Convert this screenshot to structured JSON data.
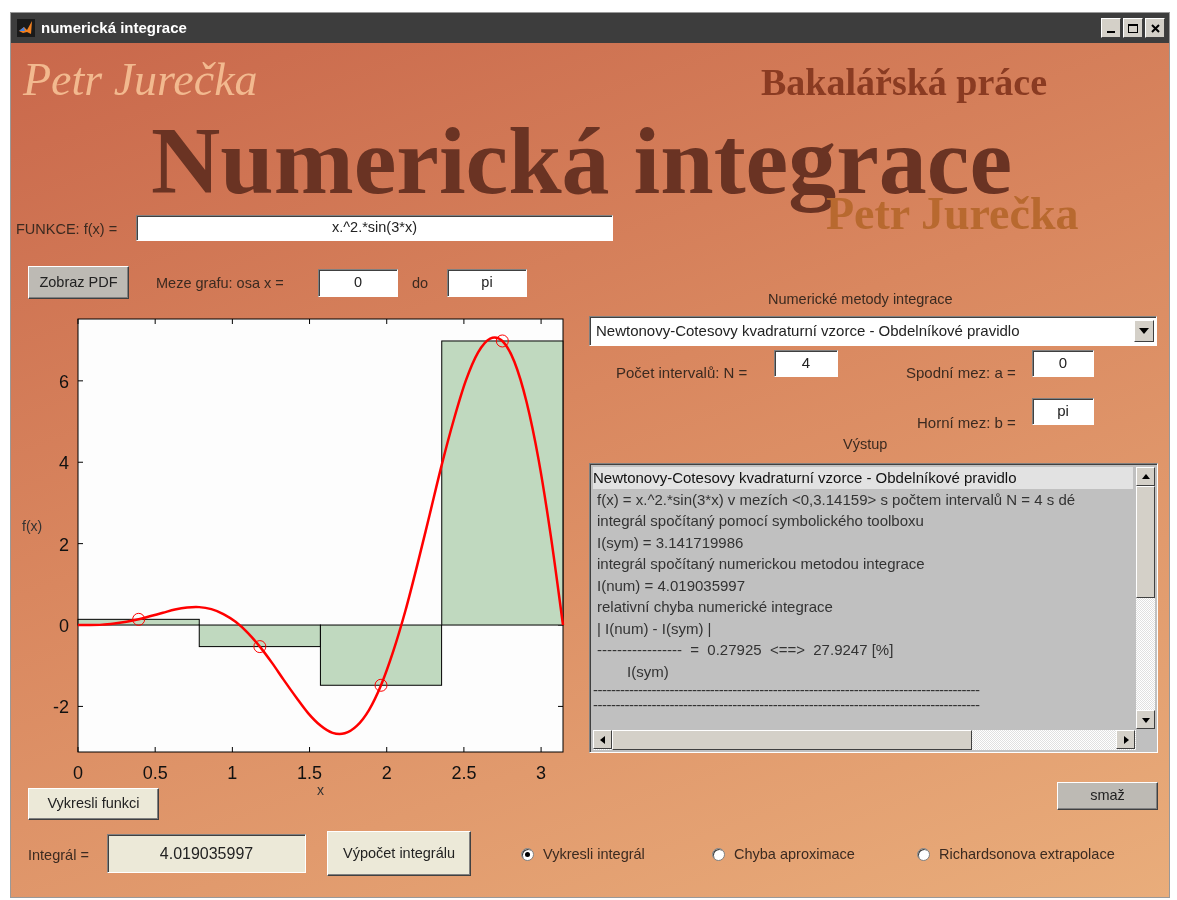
{
  "window": {
    "title": "numerická integrace"
  },
  "background_texts": [
    {
      "text": "Petr Jurečka",
      "kind": "signature"
    },
    {
      "text": "Bakalářská práce",
      "kind": "subtitle"
    },
    {
      "text": "Numerická integrace",
      "kind": "headline"
    },
    {
      "text": "Petr Jurečka",
      "kind": "emblem"
    }
  ],
  "function": {
    "label": "FUNKCE: f(x) =",
    "value": "x.^2.*sin(3*x)"
  },
  "pdf_button": "Zobraz PDF",
  "graph_limits": {
    "label": "Meze grafu: osa x =",
    "from": "0",
    "to_label": "do",
    "to": "pi"
  },
  "methods": {
    "label": "Numerické metody integrace",
    "selected": "Newtonovy-Cotesovy kvadraturní vzorce - Obdelníkové pravidlo"
  },
  "parameters": [
    {
      "label": "Počet intervalů: N =",
      "value": "4"
    },
    {
      "label": "Spodní mez: a =",
      "value": "0"
    },
    {
      "label": "Horní mez: b =",
      "value": "pi"
    }
  ],
  "output": {
    "label": "Výstup",
    "lines": [
      {
        "text": "Newtonovy-Cotesovy kvadraturní vzorce - Obdelníkové pravidlo",
        "kind": "heading",
        "selected": true
      },
      {
        "text": "f(x) = x.^2.*sin(3*x) v mezích <0,3.14159> s počtem intervalů N = 4 s dé",
        "kind": "text",
        "selected": false
      },
      {
        "text": "integrál spočítaný pomocí symbolického toolboxu",
        "kind": "text",
        "selected": false
      },
      {
        "text": "I(sym) = 3.141719986",
        "kind": "text",
        "selected": false
      },
      {
        "text": "integrál spočítaný numerickou metodou integrace",
        "kind": "text",
        "selected": false
      },
      {
        "text": "I(num) = 4.019035997",
        "kind": "text",
        "selected": false
      },
      {
        "text": "relativní chyba numerické integrace",
        "kind": "text",
        "selected": false
      },
      {
        "text": "| I(num) - I(sym) |",
        "kind": "text",
        "selected": false
      },
      {
        "text": "-----------------  =  0.27925  <==>  27.9247 [%]",
        "kind": "text",
        "selected": false
      },
      {
        "text": "I(sym)",
        "kind": "denominator",
        "selected": false
      },
      {
        "text": "--------------------------------------------------------------------------------------",
        "kind": "rule",
        "selected": false
      },
      {
        "text": "--------------------------------------------------------------------------------------",
        "kind": "rule",
        "selected": false
      }
    ]
  },
  "plot": {
    "chart_data": {
      "type": "line",
      "xlabel": "x",
      "ylabel": "f(x)",
      "xlim": [
        0,
        3.142
      ],
      "ylim": [
        -3.12,
        7.52
      ],
      "xticks": [
        0,
        0.5,
        1,
        1.5,
        2,
        2.5,
        3
      ],
      "yticks": [
        -2,
        0,
        2,
        4,
        6
      ],
      "x": [
        0,
        0.079,
        0.157,
        0.236,
        0.314,
        0.393,
        0.471,
        0.55,
        0.628,
        0.707,
        0.785,
        0.864,
        0.942,
        1.021,
        1.1,
        1.178,
        1.257,
        1.335,
        1.414,
        1.492,
        1.571,
        1.649,
        1.728,
        1.806,
        1.885,
        1.963,
        2.042,
        2.121,
        2.199,
        2.278,
        2.356,
        2.435,
        2.513,
        2.592,
        2.67,
        2.749,
        2.827,
        2.906,
        2.985,
        3.063,
        3.142
      ],
      "series": [
        {
          "type": "bar",
          "color": "#c0d9bf",
          "values": [
            null,
            null,
            null,
            null,
            null,
            0.14,
            null,
            null,
            null,
            null,
            null,
            null,
            null,
            null,
            null,
            -0.53,
            null,
            null,
            null,
            null,
            null,
            null,
            null,
            null,
            null,
            -1.48,
            null,
            null,
            null,
            null,
            null,
            null,
            null,
            null,
            null,
            6.98,
            null,
            null,
            null,
            null,
            null
          ]
        },
        {
          "type": "line",
          "color": "#ff0000",
          "values": [
            0,
            0,
            0.01,
            0.04,
            0.08,
            0.14,
            0.22,
            0.3,
            0.38,
            0.43,
            0.44,
            0.39,
            0.27,
            0.08,
            -0.19,
            -0.53,
            -0.93,
            -1.36,
            -1.78,
            -2.17,
            -2.47,
            -2.65,
            -2.66,
            -2.48,
            -2.09,
            -1.48,
            -0.65,
            0.35,
            1.49,
            2.71,
            3.93,
            5.05,
            6.01,
            6.7,
            7.04,
            6.98,
            6.47,
            5.48,
            4.04,
            2.19,
            0
          ]
        }
      ]
    }
  },
  "plot_button": "Vykresli funkci",
  "clear_button": "smaž",
  "integral": {
    "label": "Integrál =",
    "value": "4.019035997"
  },
  "compute_button": "Výpočet integrálu",
  "display_options": [
    {
      "label": "Vykresli integrál",
      "selected": true
    },
    {
      "label": "Chyba aproximace",
      "selected": false
    },
    {
      "label": "Richardsonova extrapolace",
      "selected": false
    }
  ]
}
